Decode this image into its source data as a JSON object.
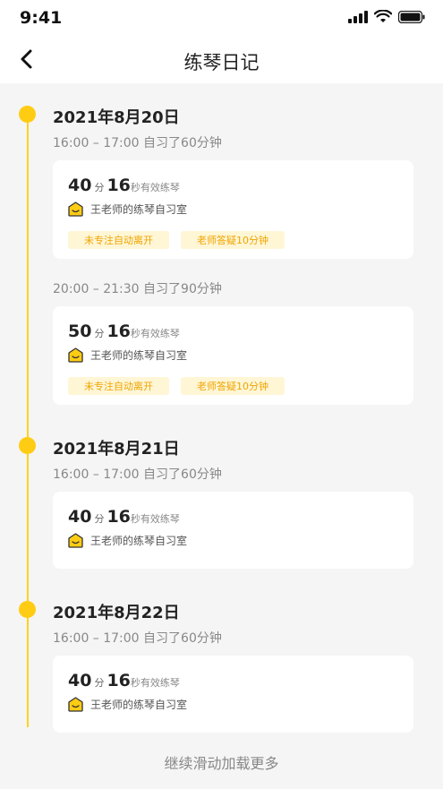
{
  "status": {
    "time": "9:41"
  },
  "header": {
    "title": "练琴日记"
  },
  "days": [
    {
      "date": "2021年8月20日",
      "sessions": [
        {
          "time": "16:00 – 17:00 自习了60分钟",
          "minutes": "40",
          "min_unit": "分",
          "seconds": "16",
          "sec_suffix": "秒有效练琴",
          "room": "王老师的练琴自习室",
          "tags": [
            "未专注自动离开",
            "老师答疑10分钟"
          ]
        },
        {
          "time": "20:00 – 21:30 自习了90分钟",
          "minutes": "50",
          "min_unit": "分",
          "seconds": "16",
          "sec_suffix": "秒有效练琴",
          "room": "王老师的练琴自习室",
          "tags": [
            "未专注自动离开",
            "老师答疑10分钟"
          ]
        }
      ]
    },
    {
      "date": "2021年8月21日",
      "sessions": [
        {
          "time": "16:00 – 17:00 自习了60分钟",
          "minutes": "40",
          "min_unit": "分",
          "seconds": "16",
          "sec_suffix": "秒有效练琴",
          "room": "王老师的练琴自习室"
        }
      ]
    },
    {
      "date": "2021年8月22日",
      "sessions": [
        {
          "time": "16:00 – 17:00 自习了60分钟",
          "minutes": "40",
          "min_unit": "分",
          "seconds": "16",
          "sec_suffix": "秒有效练琴",
          "room": "王老师的练琴自习室"
        }
      ]
    }
  ],
  "footer": {
    "load_more": "继续滑动加载更多"
  },
  "colors": {
    "accent": "#ffcc14",
    "tag_bg": "#fff6d6",
    "tag_text": "#f0a400"
  }
}
